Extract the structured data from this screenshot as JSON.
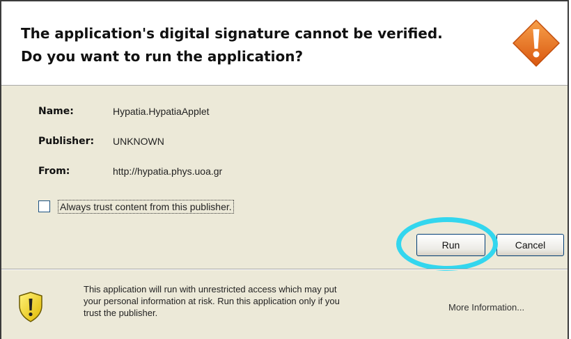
{
  "header": {
    "title_line1": "The application's digital signature cannot be verified.",
    "title_line2": "Do you want to run the application?",
    "icon": "warning-diamond-icon",
    "icon_color": "#e8731c"
  },
  "details": [
    {
      "label": "Name:",
      "value": "Hypatia.HypatiaApplet"
    },
    {
      "label": "Publisher:",
      "value": "UNKNOWN"
    },
    {
      "label": "From:",
      "value": "http://hypatia.phys.uoa.gr"
    }
  ],
  "trust_checkbox": {
    "label": "Always trust content from this publisher.",
    "checked": false
  },
  "buttons": {
    "run": "Run",
    "cancel": "Cancel"
  },
  "highlight": {
    "target": "run-button",
    "color": "#33d6ee"
  },
  "footer": {
    "icon": "warning-shield-icon",
    "line1": "This application will run with unrestricted access which may put",
    "line2": "your personal information at risk. Run this application only if you",
    "line3": "trust the publisher.",
    "more_info": "More Information..."
  }
}
